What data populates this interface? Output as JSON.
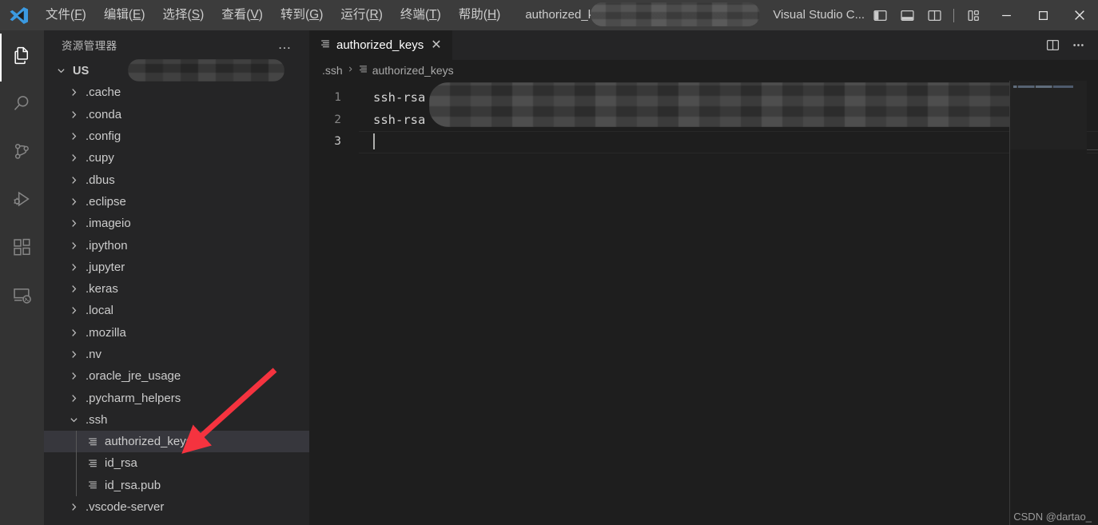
{
  "window": {
    "app_name": "Visual Studio C...",
    "title_file": "authorized_keys",
    "title_redacted": true,
    "logo_icon": "vscode-logo-icon"
  },
  "menubar": {
    "items": [
      {
        "label": "文件",
        "accel": "F"
      },
      {
        "label": "编辑",
        "accel": "E"
      },
      {
        "label": "选择",
        "accel": "S"
      },
      {
        "label": "查看",
        "accel": "V"
      },
      {
        "label": "转到",
        "accel": "G"
      },
      {
        "label": "运行",
        "accel": "R"
      },
      {
        "label": "终端",
        "accel": "T"
      },
      {
        "label": "帮助",
        "accel": "H"
      }
    ]
  },
  "layout_controls": [
    {
      "name": "toggle-primary-sidebar",
      "icon": "panel-left-icon"
    },
    {
      "name": "toggle-panel",
      "icon": "panel-bottom-icon"
    },
    {
      "name": "toggle-secondary-sidebar",
      "icon": "panel-right-icon"
    },
    {
      "name": "customize-layout",
      "icon": "layout-grid-icon"
    }
  ],
  "window_controls": [
    {
      "name": "minimize",
      "glyph": "─"
    },
    {
      "name": "maximize",
      "glyph": "□"
    },
    {
      "name": "close",
      "glyph": "✕"
    }
  ],
  "activitybar": {
    "items": [
      {
        "name": "explorer",
        "icon": "files-icon",
        "active": true
      },
      {
        "name": "search",
        "icon": "search-icon",
        "active": false
      },
      {
        "name": "source-control",
        "icon": "source-control-icon",
        "active": false
      },
      {
        "name": "run-and-debug",
        "icon": "run-debug-icon",
        "active": false
      },
      {
        "name": "extensions",
        "icon": "extensions-icon",
        "active": false
      },
      {
        "name": "remote-explorer",
        "icon": "remote-explorer-icon",
        "active": false
      }
    ]
  },
  "sidebar": {
    "title": "资源管理器",
    "more_actions": "…",
    "root": {
      "label": "US",
      "redacted": true,
      "expanded": true
    },
    "tree": [
      {
        "label": ".cache",
        "type": "folder",
        "expanded": false,
        "depth": 1
      },
      {
        "label": ".conda",
        "type": "folder",
        "expanded": false,
        "depth": 1
      },
      {
        "label": ".config",
        "type": "folder",
        "expanded": false,
        "depth": 1
      },
      {
        "label": ".cupy",
        "type": "folder",
        "expanded": false,
        "depth": 1
      },
      {
        "label": ".dbus",
        "type": "folder",
        "expanded": false,
        "depth": 1
      },
      {
        "label": ".eclipse",
        "type": "folder",
        "expanded": false,
        "depth": 1
      },
      {
        "label": ".imageio",
        "type": "folder",
        "expanded": false,
        "depth": 1
      },
      {
        "label": ".ipython",
        "type": "folder",
        "expanded": false,
        "depth": 1
      },
      {
        "label": ".jupyter",
        "type": "folder",
        "expanded": false,
        "depth": 1
      },
      {
        "label": ".keras",
        "type": "folder",
        "expanded": false,
        "depth": 1
      },
      {
        "label": ".local",
        "type": "folder",
        "expanded": false,
        "depth": 1
      },
      {
        "label": ".mozilla",
        "type": "folder",
        "expanded": false,
        "depth": 1
      },
      {
        "label": ".nv",
        "type": "folder",
        "expanded": false,
        "depth": 1
      },
      {
        "label": ".oracle_jre_usage",
        "type": "folder",
        "expanded": false,
        "depth": 1
      },
      {
        "label": ".pycharm_helpers",
        "type": "folder",
        "expanded": false,
        "depth": 1
      },
      {
        "label": ".ssh",
        "type": "folder",
        "expanded": true,
        "depth": 1
      },
      {
        "label": "authorized_keys",
        "type": "file",
        "selected": true,
        "depth": 2
      },
      {
        "label": "id_rsa",
        "type": "file",
        "selected": false,
        "depth": 2
      },
      {
        "label": "id_rsa.pub",
        "type": "file",
        "selected": false,
        "depth": 2
      },
      {
        "label": ".vscode-server",
        "type": "folder",
        "expanded": false,
        "depth": 1
      }
    ]
  },
  "editor": {
    "tabs": [
      {
        "label": "authorized_keys",
        "icon": "file-text-icon",
        "close_glyph": "✕",
        "active": true
      }
    ],
    "tab_actions": [
      {
        "name": "split-editor-right",
        "icon": "split-editor-icon"
      },
      {
        "name": "more-editor-actions",
        "icon": "ellipsis-icon",
        "glyph": "…"
      }
    ],
    "breadcrumbs": [
      {
        "label": ".ssh",
        "icon": ""
      },
      {
        "label": "authorized_keys",
        "icon": "file-text-icon"
      }
    ],
    "lines": [
      {
        "number": "1",
        "text": "ssh-rsa",
        "redacted": true,
        "active": false
      },
      {
        "number": "2",
        "text": "ssh-rsa",
        "redacted": true,
        "active": false
      },
      {
        "number": "3",
        "text": "",
        "redacted": false,
        "active": true
      }
    ],
    "minimap_visible": true
  },
  "annotation": {
    "arrow_color": "#f5333f",
    "target": "authorized_keys"
  },
  "watermark": "CSDN @dartao_"
}
